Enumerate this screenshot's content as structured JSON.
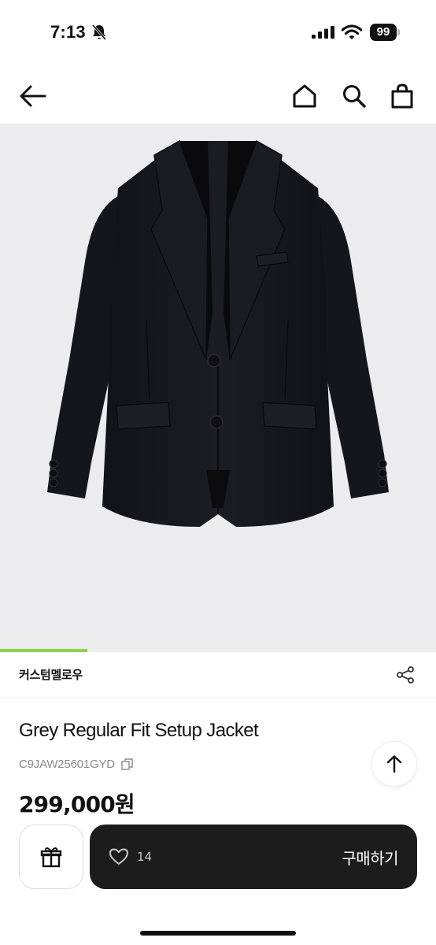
{
  "status_bar": {
    "time": "7:13",
    "battery": "99",
    "icons": [
      "bell-slash-icon",
      "cellular-signal-icon",
      "wifi-icon",
      "battery-icon"
    ]
  },
  "nav": {
    "icons": [
      "back-arrow-icon",
      "home-icon",
      "search-icon",
      "shopping-bag-icon"
    ]
  },
  "gallery": {
    "image": "black-blazer-jacket",
    "progress": 0.2
  },
  "brand": {
    "name": "커스텀멜로우",
    "share_icon": "share-icon"
  },
  "product": {
    "title": "Grey Regular Fit Setup Jacket",
    "sku": "C9JAW25601GYD",
    "price": "299,000원"
  },
  "actions": {
    "gift_icon": "gift-icon",
    "like_count": "14",
    "buy_label": "구매하기",
    "scroll_top_icon": "arrow-up-icon"
  },
  "colors": {
    "accent": "#8fd14f",
    "buy_bar": "#1c1c1c",
    "image_bg": "#ececee"
  }
}
